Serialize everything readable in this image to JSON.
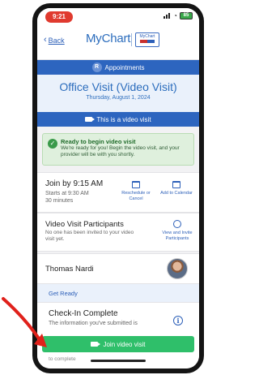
{
  "status": {
    "time": "9:21",
    "battery": "85"
  },
  "nav": {
    "back_label": "Back",
    "brand": "MyChart",
    "logo_text": "MyChart"
  },
  "appointments_bar": {
    "badge": "R",
    "label": "Appointments"
  },
  "header": {
    "title": "Office Visit (Video Visit)",
    "date": "Thursday, August 1, 2024"
  },
  "video_banner": {
    "label": "This is a video visit"
  },
  "ready": {
    "title": "Ready to begin video visit",
    "text": "We're ready for you! Begin the video visit, and your provider will be with you shortly."
  },
  "join_card": {
    "title": "Join by 9:15 AM",
    "starts": "Starts at 9:30 AM",
    "duration": "30 minutes",
    "reschedule": "Reschedule or Cancel",
    "add_calendar": "Add to Calendar"
  },
  "participants": {
    "title": "Video Visit Participants",
    "text": "No one has been invited to your video visit yet.",
    "action": "View and Invite Participants"
  },
  "provider": {
    "name": "Thomas Nardi"
  },
  "get_ready": {
    "label": "Get Ready"
  },
  "checkin": {
    "title": "Check-In Complete",
    "text": "The information you've submitted is",
    "cut_text": "to complete"
  },
  "join_button": {
    "label": "Join video visit"
  },
  "colors": {
    "accent": "#2d65bf",
    "success": "#2fbf6a",
    "arrow": "#e0211b"
  }
}
